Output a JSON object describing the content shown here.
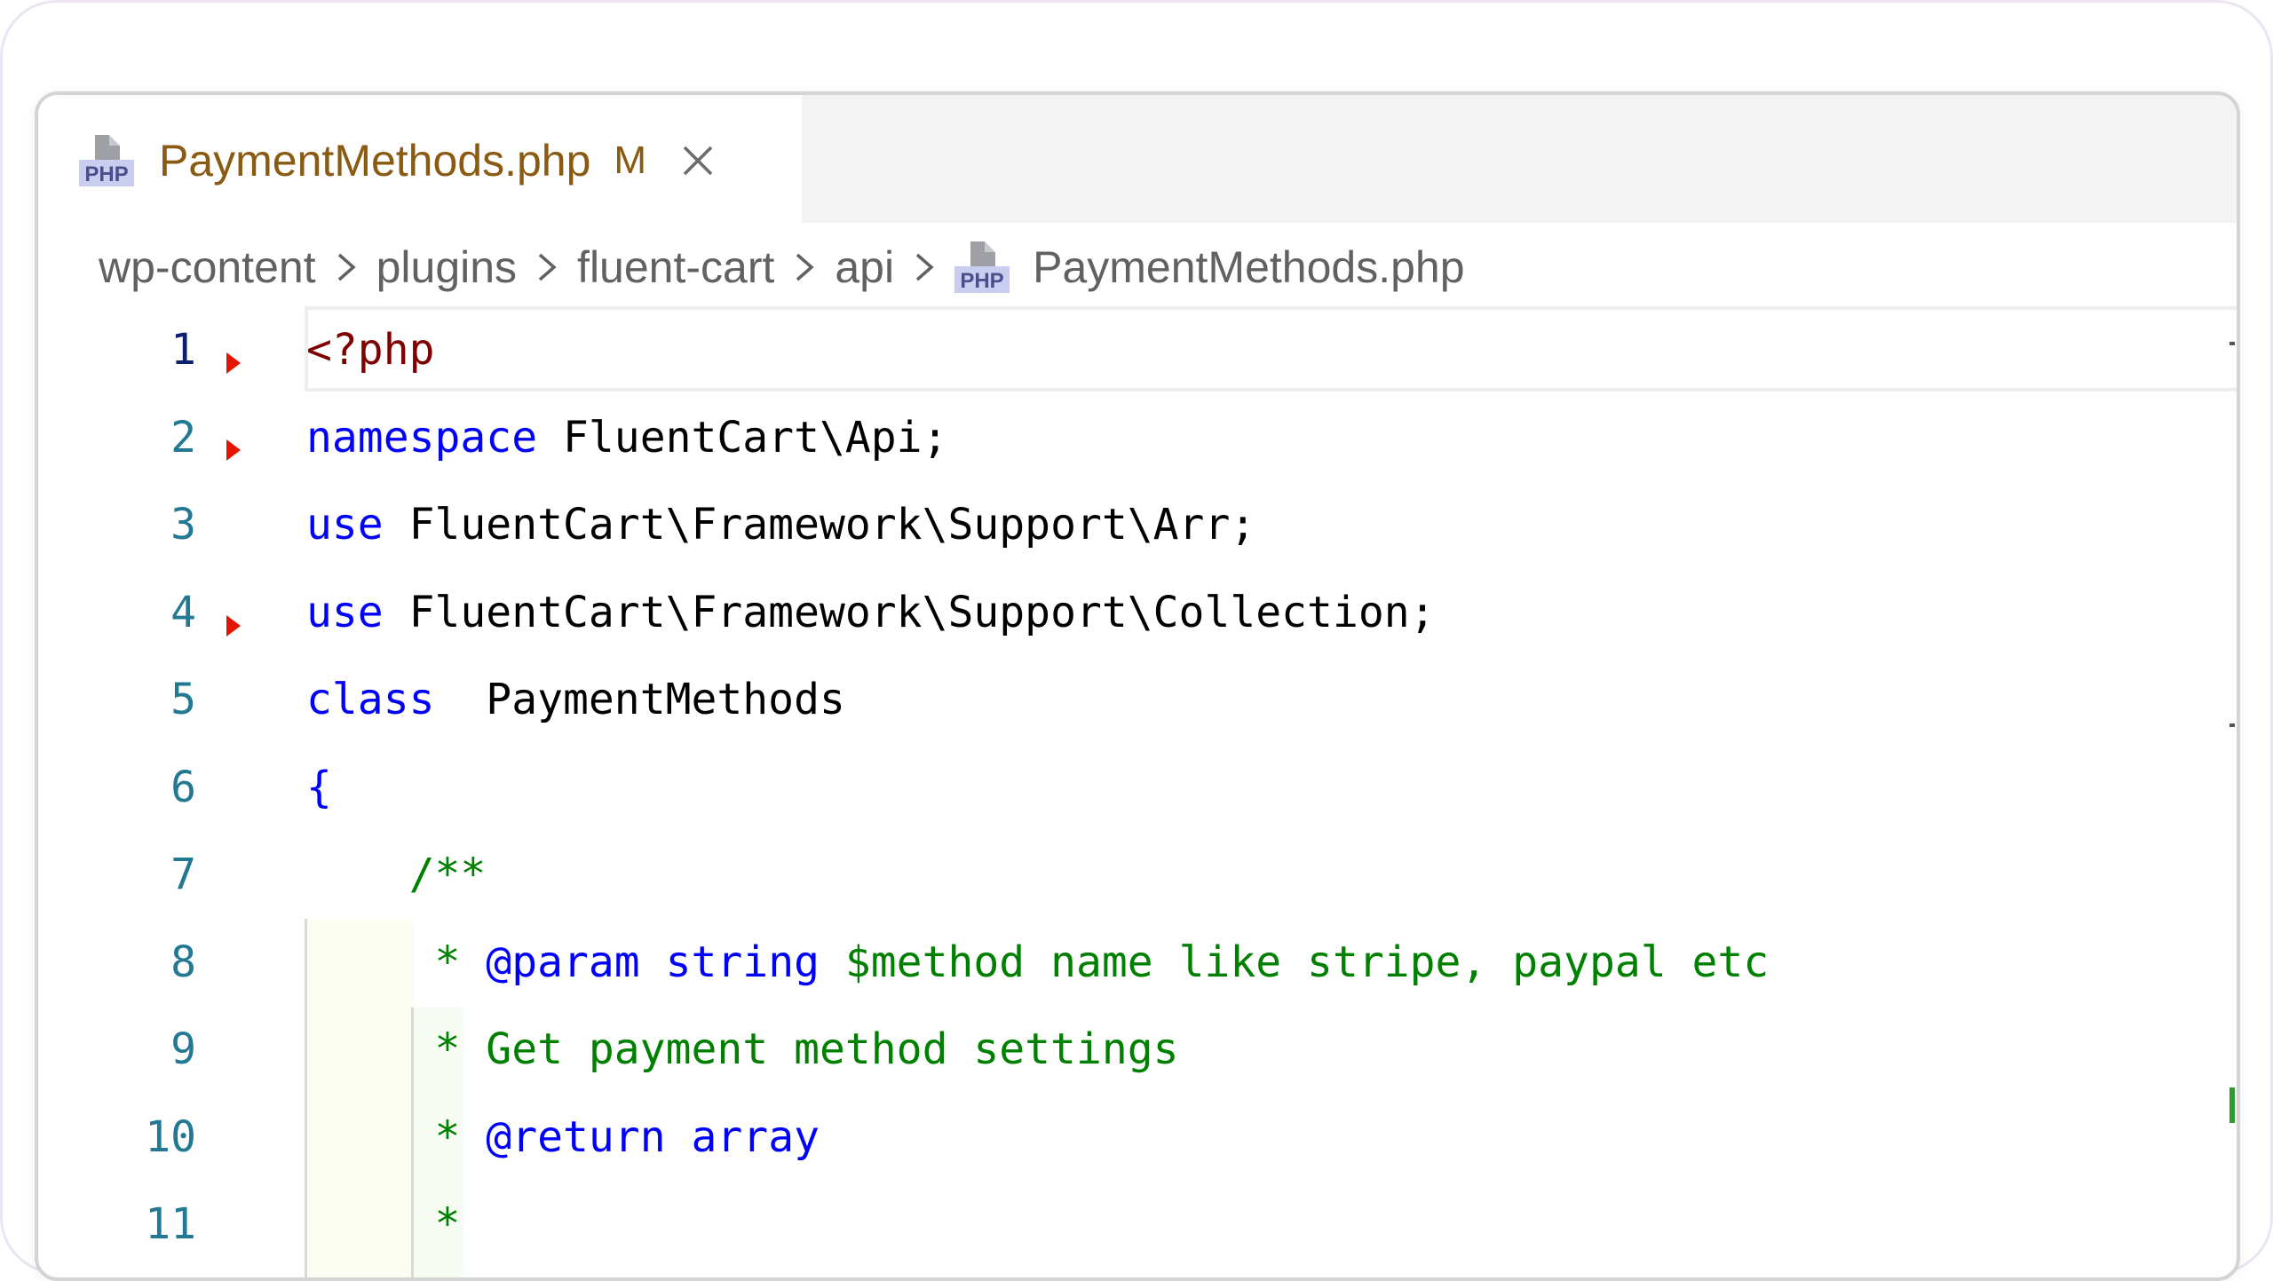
{
  "tab": {
    "title": "PaymentMethods.php",
    "modified_badge": "M",
    "icon": "php-file-icon",
    "icon_text": "PHP",
    "close_icon": "close-icon"
  },
  "breadcrumb": {
    "items": [
      "wp-content",
      "plugins",
      "fluent-cart",
      "api"
    ],
    "file": "PaymentMethods.php",
    "separator_icon": "chevron-right-icon"
  },
  "colors": {
    "tab_title": "#8a5a12",
    "keyword": "#0000ff",
    "php_tag": "#800000",
    "comment": "#008000",
    "line_number": "#237893",
    "fold_marker": "#e51400"
  },
  "code": {
    "lines": [
      {
        "number": "1",
        "tokens": [
          {
            "t": "tag",
            "v": "<?php"
          }
        ]
      },
      {
        "number": "2",
        "tokens": [
          {
            "t": "kw",
            "v": "namespace"
          },
          {
            "t": "plain",
            "v": " FluentCart\\Api;"
          }
        ]
      },
      {
        "number": "3",
        "tokens": [
          {
            "t": "kw",
            "v": "use"
          },
          {
            "t": "plain",
            "v": " FluentCart\\Framework\\Support\\Arr;"
          }
        ]
      },
      {
        "number": "4",
        "tokens": [
          {
            "t": "kw",
            "v": "use"
          },
          {
            "t": "plain",
            "v": " FluentCart\\Framework\\Support\\Collection;"
          }
        ]
      },
      {
        "number": "5",
        "tokens": [
          {
            "t": "kw",
            "v": "class"
          },
          {
            "t": "plain",
            "v": "  PaymentMethods"
          }
        ]
      },
      {
        "number": "6",
        "tokens": [
          {
            "t": "kw",
            "v": "{"
          }
        ]
      },
      {
        "number": "7",
        "tokens": [
          {
            "t": "comment",
            "v": "    /**"
          }
        ]
      },
      {
        "number": "8",
        "tokens": [
          {
            "t": "comment",
            "v": "     * "
          },
          {
            "t": "dockw",
            "v": "@param"
          },
          {
            "t": "comment",
            "v": " "
          },
          {
            "t": "dockw",
            "v": "string"
          },
          {
            "t": "comment",
            "v": " $method name like stripe, paypal etc"
          }
        ]
      },
      {
        "number": "9",
        "tokens": [
          {
            "t": "comment",
            "v": "     * Get payment method settings"
          }
        ]
      },
      {
        "number": "10",
        "tokens": [
          {
            "t": "comment",
            "v": "     * "
          },
          {
            "t": "dockw",
            "v": "@return"
          },
          {
            "t": "comment",
            "v": " "
          },
          {
            "t": "dockw",
            "v": "array"
          }
        ]
      },
      {
        "number": "11",
        "tokens": [
          {
            "t": "comment",
            "v": "     *"
          }
        ]
      }
    ]
  }
}
